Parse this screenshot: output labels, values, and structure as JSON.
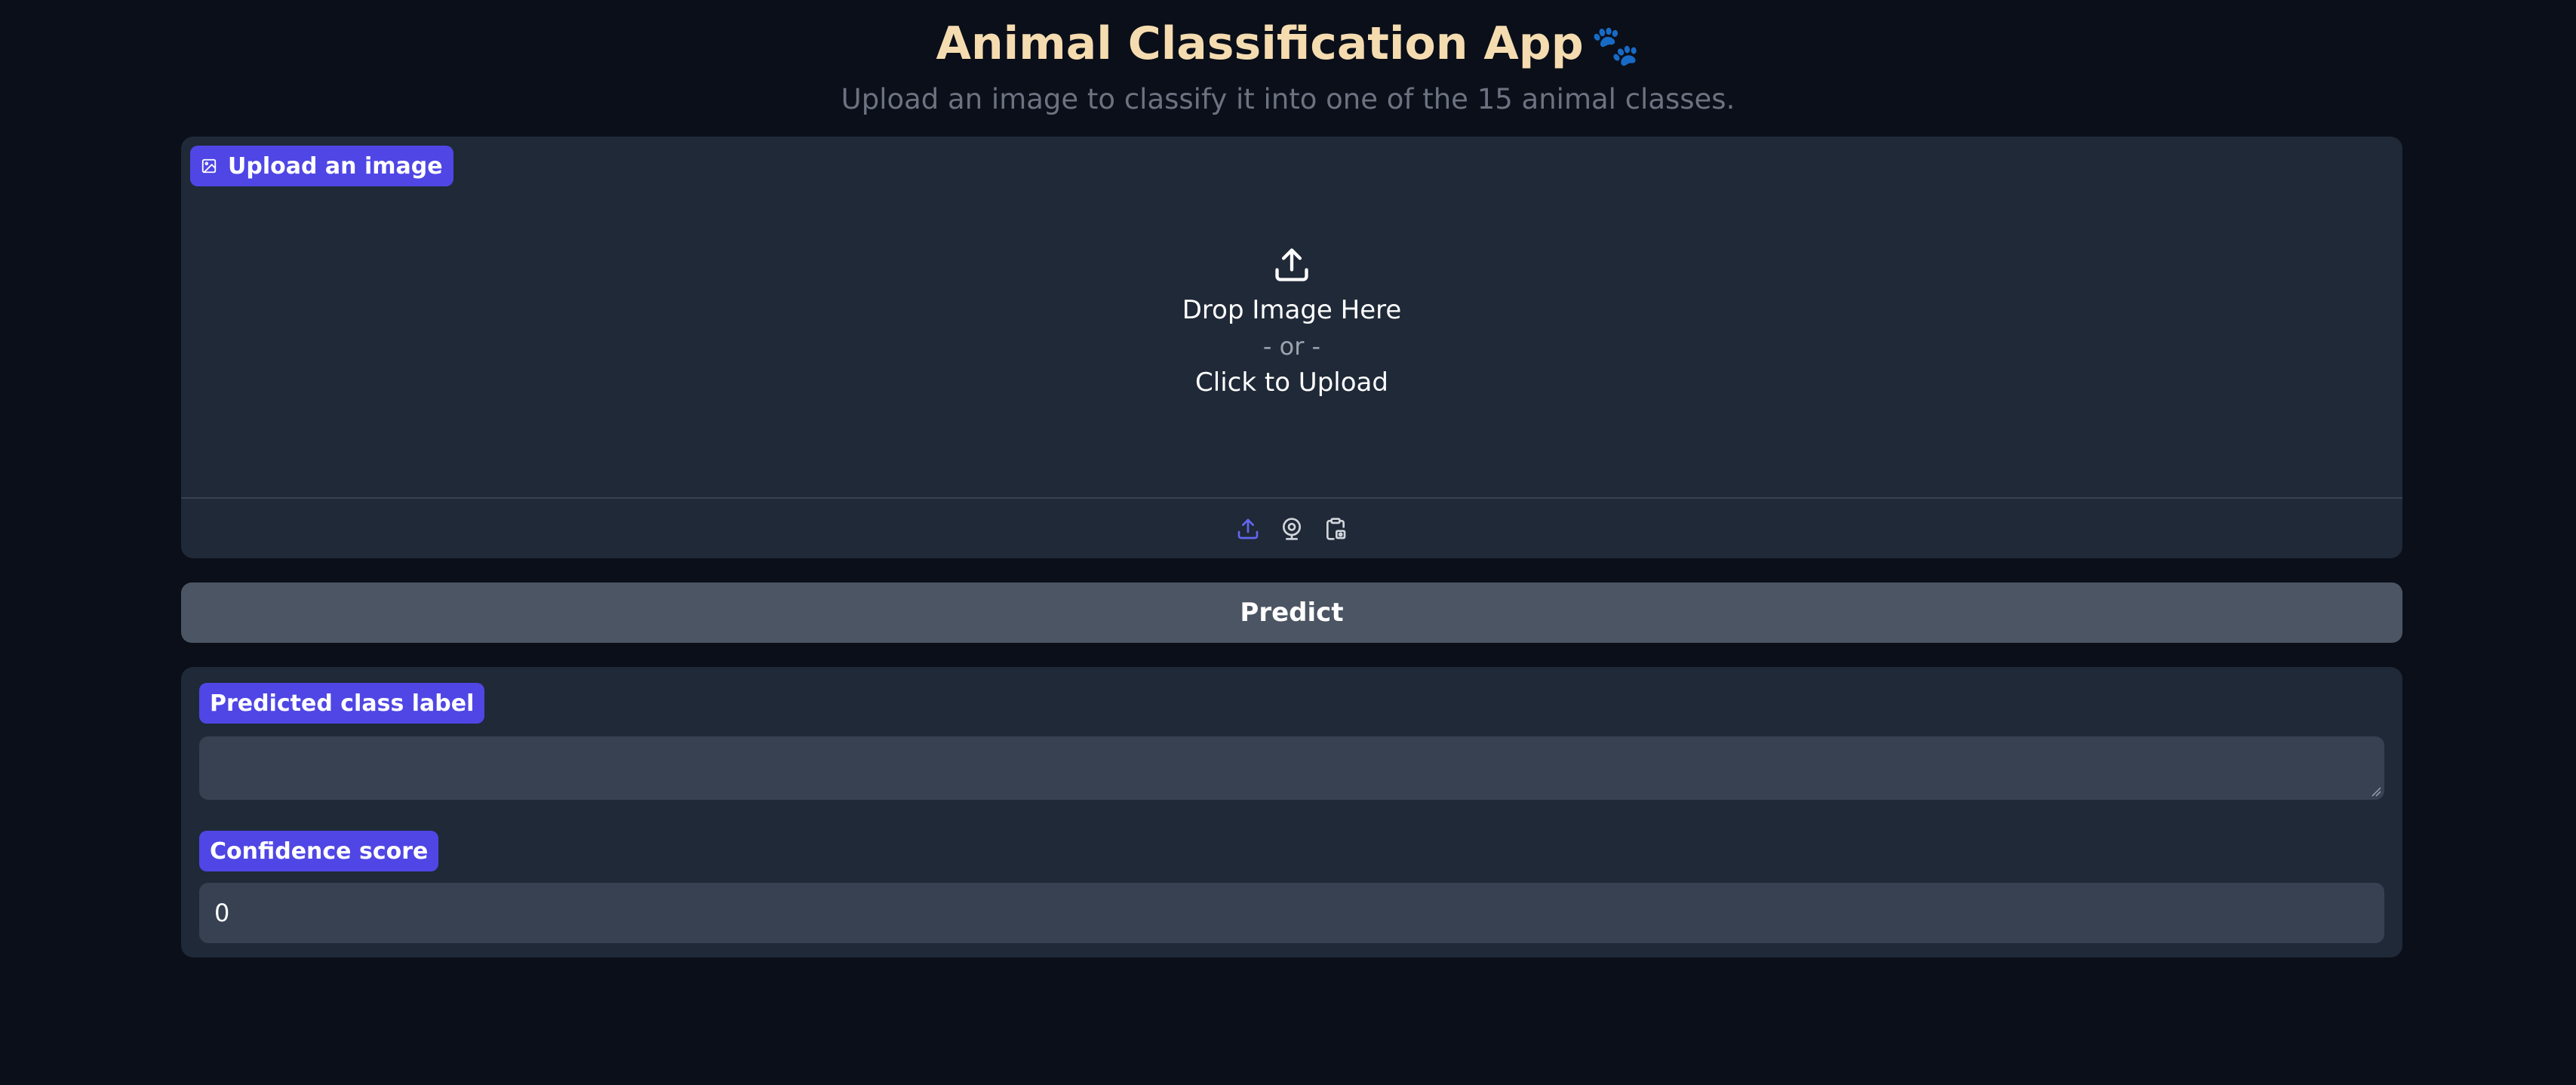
{
  "header": {
    "title": "Animal Classification App",
    "subtitle": "Upload an image to classify it into one of the 15 animal classes."
  },
  "upload": {
    "label": "Upload an image",
    "drop_text": "Drop Image Here",
    "or_text": "- or -",
    "click_text": "Click to Upload",
    "sources": [
      "upload-icon",
      "webcam-icon",
      "clipboard-icon"
    ]
  },
  "predict": {
    "label": "Predict"
  },
  "outputs": {
    "class_label": {
      "label": "Predicted class label",
      "value": ""
    },
    "confidence": {
      "label": "Confidence score",
      "value": "0"
    }
  },
  "colors": {
    "background": "#0b0f19",
    "panel": "#1f2937",
    "accent": "#4f46e5",
    "title": "#f5dcb0",
    "button": "#4b5563",
    "input": "#374151"
  }
}
